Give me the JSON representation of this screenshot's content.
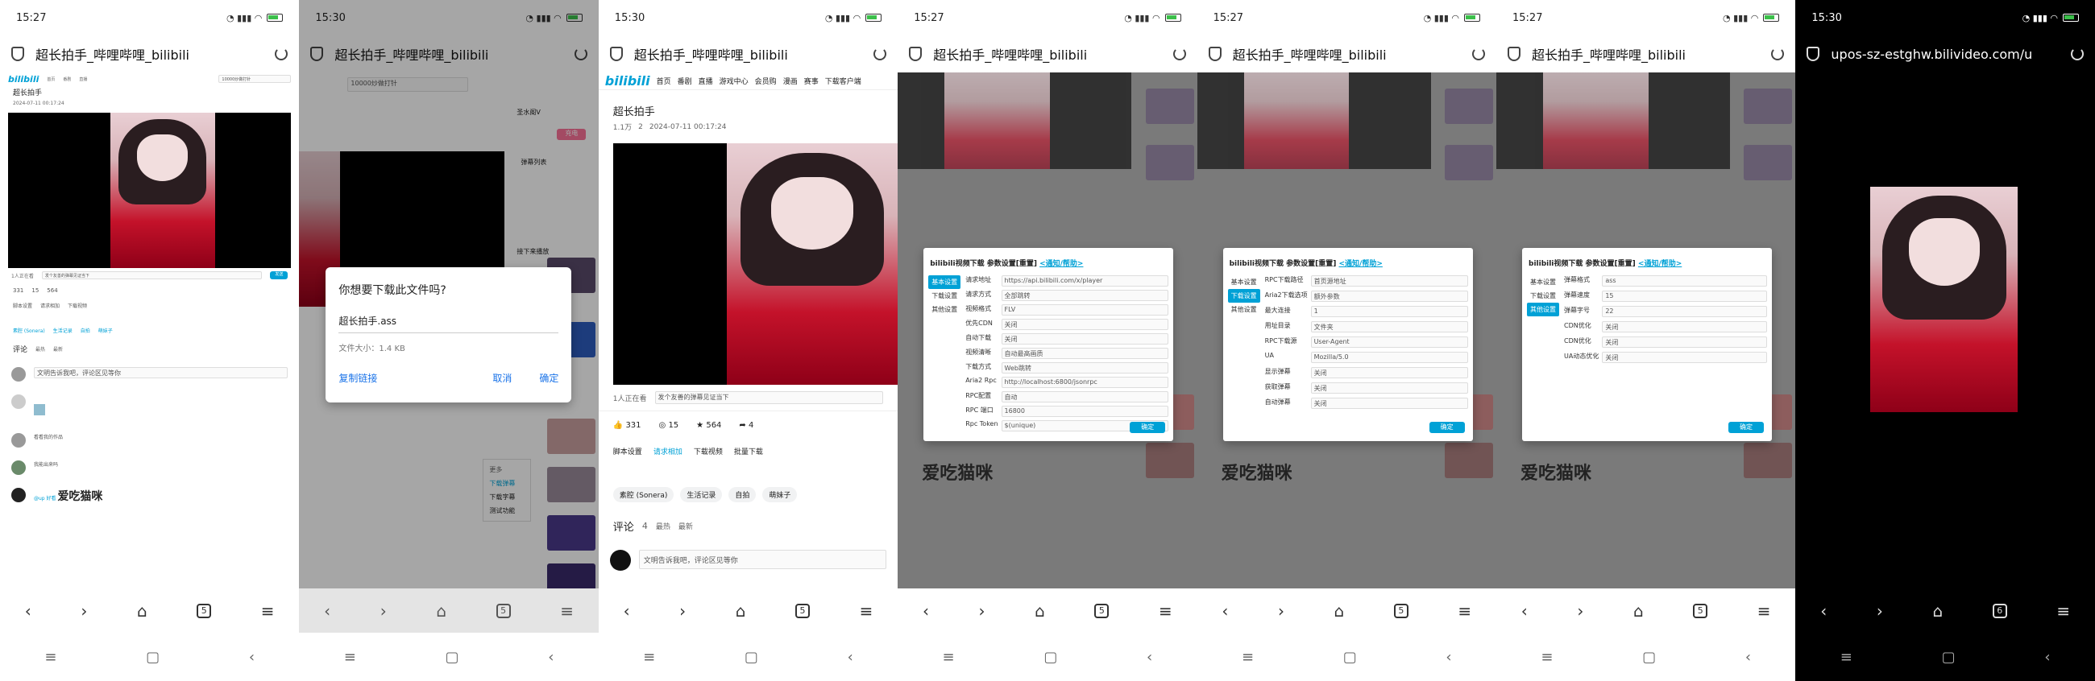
{
  "phones": [
    {
      "time": "15:27",
      "url": "超长拍手_哔哩哔哩_bilibili",
      "tabs": "5"
    },
    {
      "time": "15:30",
      "url": "超长拍手_哔哩哔哩_bilibili",
      "tabs": "5"
    },
    {
      "time": "15:30",
      "url": "超长拍手_哔哩哔哩_bilibili",
      "tabs": "5"
    },
    {
      "time": "15:27",
      "url": "超长拍手_哔哩哔哩_bilibili",
      "tabs": "5"
    },
    {
      "time": "15:27",
      "url": "超长拍手_哔哩哔哩_bilibili",
      "tabs": "5"
    },
    {
      "time": "15:27",
      "url": "超长拍手_哔哩哔哩_bilibili",
      "tabs": "5"
    },
    {
      "time": "15:30",
      "url": "upos-sz-estghw.bilivideo.com/u",
      "tabs": "6"
    }
  ],
  "logo": "bilibili",
  "video_title": "超长拍手",
  "video_meta": {
    "views": "1.1万",
    "danmaku": "2",
    "date": "2024-07-11 00:17:24"
  },
  "nav": [
    "首页",
    "番剧",
    "直播",
    "游戏中心",
    "会员购",
    "漫画",
    "赛事",
    "下载客户端"
  ],
  "search_placeholder": "10000炒做打针",
  "actions": {
    "like": "331",
    "coin": "15",
    "star": "564",
    "share": "4"
  },
  "danmaku_count": "1人正在看",
  "danmaku_placeholder": "发个友善的弹幕见证当下",
  "tools": {
    "settings": "脚本设置",
    "request": "请求相加",
    "download": "下载视频",
    "batch": "批量下载"
  },
  "tags": [
    "素腔 (Sonera)",
    "生活记录",
    "自拍",
    "萌妹子"
  ],
  "comments": {
    "title": "评论",
    "count": "4",
    "sort_hot": "最热",
    "sort_new": "最新",
    "placeholder": "文明告诉我吧，评论区见等你"
  },
  "dialog": {
    "title": "你想要下载此文件吗?",
    "filename": "超长拍手.ass",
    "size": "文件大小：1.4 KB",
    "copy": "复制链接",
    "cancel": "取消",
    "confirm": "确定"
  },
  "menu": {
    "more": "更多",
    "items": [
      "下载弹幕",
      "下载字幕",
      "测试功能"
    ]
  },
  "side": {
    "uploader": "圣水阁V",
    "follow": "充电",
    "playlist": "弹幕列表",
    "up_next": "接下来播放"
  },
  "settings": {
    "title": "bilibili视频下载 参数设置[重置]",
    "help": "<通知/帮助>",
    "tabs": [
      "基本设置",
      "下载设置",
      "其他设置"
    ],
    "ok": "确定",
    "panel1": [
      [
        "请求地址",
        "https://api.bilibili.com/x/player"
      ],
      [
        "请求方式",
        "全部跳转"
      ],
      [
        "视频格式",
        "FLV"
      ],
      [
        "优先CDN",
        "关闭"
      ],
      [
        "自动下载",
        "关闭"
      ],
      [
        "视频清晰",
        "自动最高画质"
      ],
      [
        "下载方式",
        "Web跳转"
      ],
      [
        "Aria2 Rpc",
        "http://localhost:6800/jsonrpc"
      ],
      [
        "RPC配置",
        "自动"
      ],
      [
        "RPC 端口",
        "16800"
      ],
      [
        "Rpc Token",
        "$(unique)"
      ]
    ],
    "panel2": [
      [
        "RPC下载路径",
        "首页源地址"
      ],
      [
        "Aria2下载选项",
        "额外参数"
      ],
      [
        "最大连接",
        "1"
      ],
      [
        "用址目录",
        "文件夹"
      ],
      [
        "RPC下载源",
        "User-Agent"
      ],
      [
        "UA",
        "Mozilla/5.0"
      ],
      [
        "显示弹幕",
        "关闭"
      ],
      [
        "获取弹幕",
        "关闭"
      ],
      [
        "自动弹幕",
        "关闭"
      ]
    ],
    "panel3": [
      [
        "弹幕格式",
        "ass"
      ],
      [
        "弹幕速度",
        "15"
      ],
      [
        "弹幕字号",
        "22"
      ],
      [
        "CDN优化",
        "关闭"
      ],
      [
        "CDN优化",
        "关闭"
      ],
      [
        "UA动态优化",
        "关闭"
      ]
    ]
  },
  "watermark": "爱吃猫咪"
}
